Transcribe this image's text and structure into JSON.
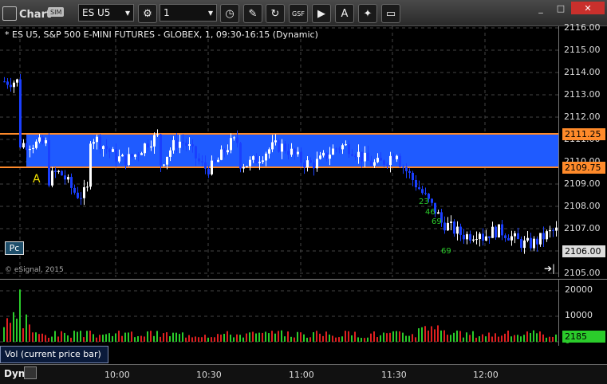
{
  "window": {
    "title": "Chart",
    "sim_badge": "SIM",
    "symbol": "ES U5",
    "interval": "1"
  },
  "toolbar_icons": [
    "gear-icon",
    "clock-icon",
    "pencil-icon",
    "refresh-icon",
    "gsf-icon",
    "play-icon",
    "alert-icon",
    "tag-icon",
    "comment-icon"
  ],
  "chart": {
    "header": "* ES U5, S&P 500 E-MINI FUTURES - GLOBEX, 1, 09:30-16:15 (Dynamic)",
    "copyright": "© eSignal, 2015",
    "marker_label": "A",
    "pc_label": "Pc",
    "price_labels": [
      "2116.00",
      "2115.00",
      "2114.00",
      "2113.00",
      "2112.00",
      "2111.00",
      "2110.00",
      "2109.00",
      "2108.00",
      "2107.00",
      "2106.00",
      "2105.00"
    ],
    "upper_line": "2111.25",
    "lower_line": "2109.75",
    "last_price": "2106.00",
    "annotations": [
      "23",
      "46",
      "69"
    ]
  },
  "volume": {
    "label": "Vol (current price bar)",
    "scale": [
      "20000",
      "10000",
      "0"
    ],
    "current": "2185"
  },
  "time_axis": {
    "mode": "Dyn",
    "labels": [
      "10:00",
      "10:30",
      "11:00",
      "11:30",
      "12:00"
    ]
  },
  "colors": {
    "band": "#1f5bff",
    "band_line": "#ff8a2a",
    "up_candle": "#ffffff",
    "down_candle": "#1a3fff",
    "vol_up": "#2bcc2b",
    "vol_down": "#e02020",
    "grid": "#444444"
  }
}
